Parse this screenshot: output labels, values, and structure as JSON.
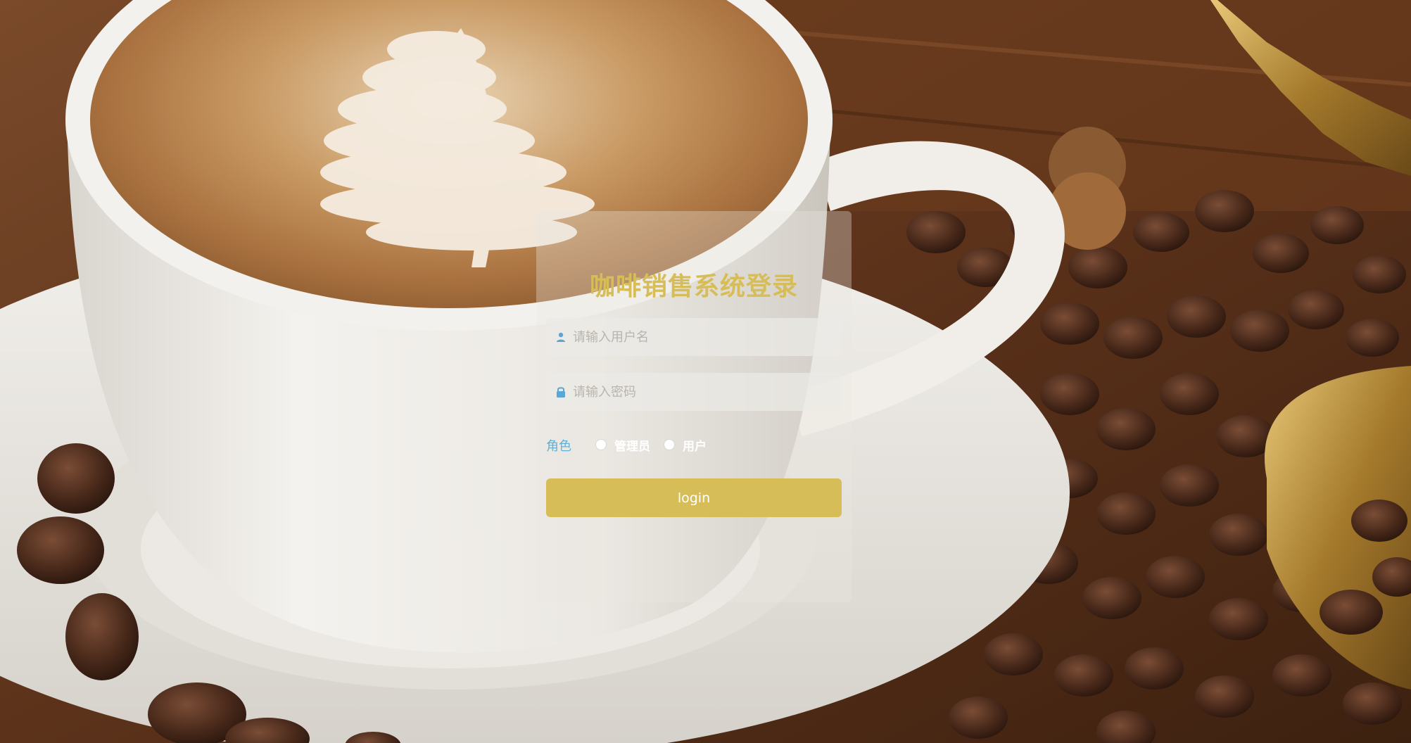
{
  "login": {
    "title": "咖啡销售系统登录",
    "username_placeholder": "请输入用户名",
    "password_placeholder": "请输入密码",
    "role_label": "角色",
    "roles": [
      "管理员",
      "用户"
    ],
    "button_label": "login"
  },
  "icons": {
    "username": "user-icon",
    "password": "lock-icon"
  },
  "colors": {
    "title": "#d7bd58",
    "button": "#d6bd58",
    "role_label": "#63b0d6",
    "icon": "#5aa6d4"
  }
}
